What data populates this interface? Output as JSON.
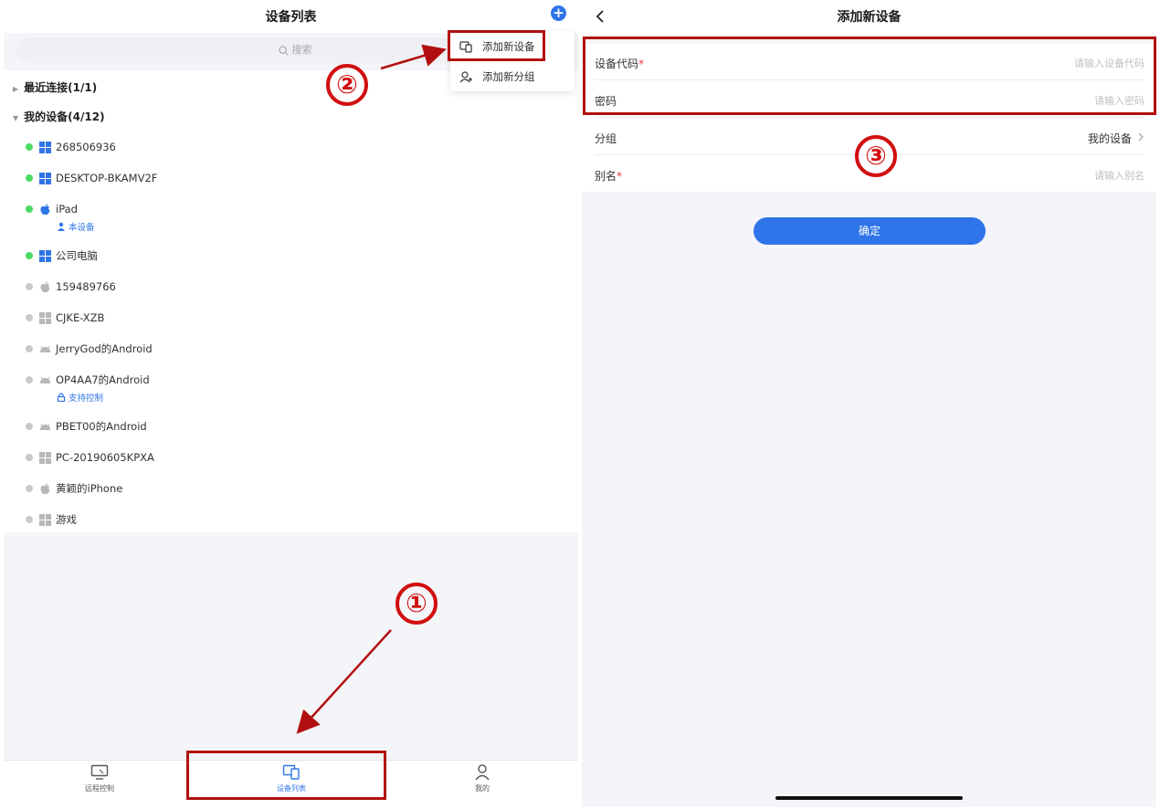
{
  "left": {
    "title": "设备列表",
    "search_placeholder": "搜索",
    "groups": {
      "recent": "最近连接(1/1)",
      "mine": "我的设备(4/12)"
    },
    "devices": [
      {
        "name": "268506936",
        "status": "online",
        "os": "windows"
      },
      {
        "name": "DESKTOP-BKAMV2F",
        "status": "online",
        "os": "windows"
      },
      {
        "name": "iPad",
        "status": "online",
        "os": "apple",
        "tag": "本设备"
      },
      {
        "name": "公司电脑",
        "status": "online",
        "os": "windows"
      },
      {
        "name": "159489766",
        "status": "offline",
        "os": "apple"
      },
      {
        "name": "CJKE-XZB",
        "status": "offline",
        "os": "windows"
      },
      {
        "name": "JerryGod的Android",
        "status": "offline",
        "os": "android"
      },
      {
        "name": "OP4AA7的Android",
        "status": "offline",
        "os": "android",
        "tag": "支持控制"
      },
      {
        "name": "PBET00的Android",
        "status": "offline",
        "os": "android"
      },
      {
        "name": "PC-20190605KPXA",
        "status": "offline",
        "os": "windows"
      },
      {
        "name": "黄颖的iPhone",
        "status": "offline",
        "os": "apple"
      },
      {
        "name": "游戏",
        "status": "offline",
        "os": "windows"
      }
    ],
    "menu": {
      "add_device": "添加新设备",
      "add_group": "添加新分组"
    },
    "tabs": {
      "remote": "远程控制",
      "devices": "设备列表",
      "me": "我的"
    }
  },
  "right": {
    "title": "添加新设备",
    "fields": {
      "code_label": "设备代码",
      "code_placeholder": "请输入设备代码",
      "password_label": "密码",
      "password_placeholder": "请输入密码",
      "group_label": "分组",
      "group_value": "我的设备",
      "alias_label": "别名",
      "alias_placeholder": "请输入别名",
      "required_mark": "*"
    },
    "confirm": "确定"
  },
  "annotations": {
    "step1": "①",
    "step2": "②",
    "step3": "③"
  },
  "colors": {
    "accent": "#2f74e8",
    "online": "#4cd964",
    "offline": "#c9c9c9",
    "annotation": "#b21010"
  }
}
